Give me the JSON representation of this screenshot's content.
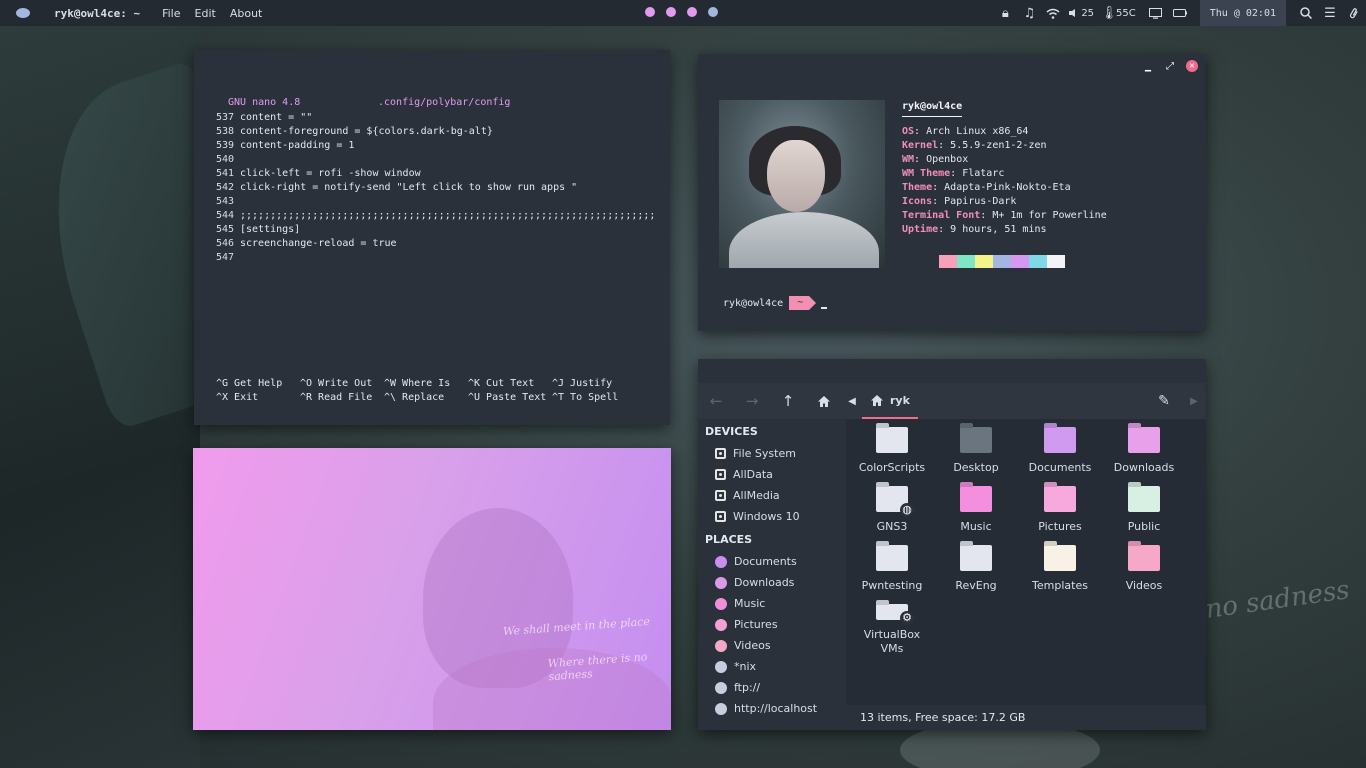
{
  "topbar": {
    "title": "ryk@owl4ce: ~",
    "menus": [
      "File",
      "Edit",
      "About"
    ],
    "workspace_colors": [
      "#e29af0",
      "#e29af0",
      "#e29af0",
      "#a3b6e0"
    ],
    "volume": "25",
    "temperature": "55C",
    "clock": "Thu @ 02:01",
    "icons": [
      "lock-icon",
      "music-icon",
      "wifi-icon",
      "volume-icon",
      "thermometer-icon",
      "monitor-icon",
      "battery-icon",
      "search-icon",
      "list-icon",
      "paperclip-icon"
    ]
  },
  "nano": {
    "app": "GNU nano 4.8",
    "file": ".config/polybar/config",
    "lines": [
      {
        "n": "537",
        "text": "content = \"\""
      },
      {
        "n": "538",
        "text": "content-foreground = ${colors.dark-bg-alt}"
      },
      {
        "n": "539",
        "text": "content-padding = 1"
      },
      {
        "n": "540",
        "text": ""
      },
      {
        "n": "541",
        "text": "click-left = rofi -show window"
      },
      {
        "n": "542",
        "text": "click-right = notify-send \"Left click to show run apps \""
      },
      {
        "n": "543",
        "text": ""
      },
      {
        "n": "544",
        "text": ";;;;;;;;;;;;;;;;;;;;;;;;;;;;;;;;;;;;;;;;;;;;;;;;;;;;;;;;;;;;;;;;;;;;;"
      },
      {
        "n": "545",
        "text": "[settings]"
      },
      {
        "n": "546",
        "text": "screenchange-reload = true"
      },
      {
        "n": "547",
        "text": ""
      }
    ],
    "shortcuts_row1": [
      "^G Get Help",
      "^O Write Out",
      "^W Where Is",
      "^K Cut Text",
      "^J Justify"
    ],
    "shortcuts_row2": [
      "^X Exit",
      "^R Read File",
      "^\\ Replace",
      "^U Paste Text",
      "^T To Spell"
    ]
  },
  "neofetch": {
    "user": "ryk@owl4ce",
    "fields": [
      {
        "k": "OS",
        "v": "Arch Linux x86_64"
      },
      {
        "k": "Kernel",
        "v": "5.5.9-zen1-2-zen"
      },
      {
        "k": "WM",
        "v": "Openbox"
      },
      {
        "k": "WM Theme",
        "v": "Flatarc"
      },
      {
        "k": "Theme",
        "v": "Adapta-Pink-Nokto-Eta"
      },
      {
        "k": "Icons",
        "v": "Papirus-Dark"
      },
      {
        "k": "Terminal Font",
        "v": "M+ 1m for Powerline"
      },
      {
        "k": "Uptime",
        "v": "9 hours, 51 mins"
      }
    ],
    "palette": [
      "#2b313b",
      "#f9a0b8",
      "#7ee6c6",
      "#f4f38a",
      "#a3b6e0",
      "#d597f0",
      "#7fd8e6",
      "#f4f4f8"
    ],
    "prompt_user": "ryk@owl4ce",
    "prompt_dir": "~"
  },
  "wallpaper_text": {
    "pink_line1": "We shall meet in the place",
    "pink_line2": "Where there is no sadness",
    "bg_script": "no sadness"
  },
  "filemanager": {
    "current": "ryk",
    "devices_label": "DEVICES",
    "devices": [
      "File System",
      "AllData",
      "AllMedia",
      "Windows 10"
    ],
    "places_label": "PLACES",
    "places": [
      {
        "label": "Documents",
        "color": "#c98ef0"
      },
      {
        "label": "Downloads",
        "color": "#d99aea"
      },
      {
        "label": "Music",
        "color": "#f08fd8"
      },
      {
        "label": "Pictures",
        "color": "#f4a0d8"
      },
      {
        "label": "Videos",
        "color": "#f4a8c8"
      },
      {
        "label": "*nix",
        "color": "#c8cde0"
      },
      {
        "label": "ftp://",
        "color": "#c8cde0"
      },
      {
        "label": "http://localhost",
        "color": "#c8cde0"
      }
    ],
    "items": [
      {
        "label": "ColorScripts",
        "color": "#e3e6ef",
        "badge": ""
      },
      {
        "label": "Desktop",
        "color": "#6b7580",
        "badge": ""
      },
      {
        "label": "Documents",
        "color": "#cf9af0",
        "badge": ""
      },
      {
        "label": "Downloads",
        "color": "#e8a0ea",
        "badge": ""
      },
      {
        "label": "GNS3",
        "color": "#e3e6ef",
        "badge": "◍"
      },
      {
        "label": "Music",
        "color": "#f48fe0",
        "badge": ""
      },
      {
        "label": "Pictures",
        "color": "#f7a8dc",
        "badge": ""
      },
      {
        "label": "Public",
        "color": "#d8f0e4",
        "badge": ""
      },
      {
        "label": "Pwntesting",
        "color": "#e3e6ef",
        "badge": ""
      },
      {
        "label": "RevEng",
        "color": "#e3e6ef",
        "badge": ""
      },
      {
        "label": "Templates",
        "color": "#f8f2e6",
        "badge": ""
      },
      {
        "label": "Videos",
        "color": "#f7a8c8",
        "badge": ""
      },
      {
        "label": "VirtualBox VMs",
        "color": "#e3e6ef",
        "badge": "⚙"
      }
    ],
    "status": "13 items, Free space: 17.2 GB"
  }
}
